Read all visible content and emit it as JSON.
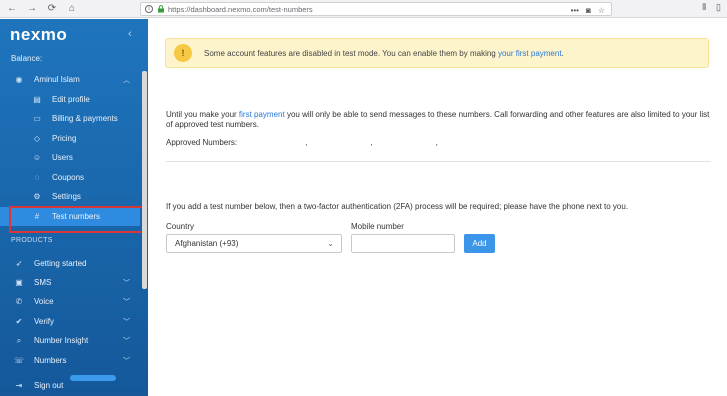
{
  "browser": {
    "url": "https://dashboard.nexmo.com/test-numbers",
    "more_label": "•••"
  },
  "sidebar": {
    "logo": "nexmo",
    "balance_label": "Balance:",
    "account": {
      "user_label": "Aminul Islam",
      "items": [
        {
          "label": "Edit profile",
          "icon": "edit-icon"
        },
        {
          "label": "Billing & payments",
          "icon": "billing-icon"
        },
        {
          "label": "Pricing",
          "icon": "tag-icon"
        },
        {
          "label": "Users",
          "icon": "users-icon"
        },
        {
          "label": "Coupons",
          "icon": "coupon-icon"
        },
        {
          "label": "Settings",
          "icon": "gear-icon"
        },
        {
          "label": "Test numbers",
          "icon": "hash-icon",
          "active": true
        }
      ]
    },
    "products_label": "PRODUCTS",
    "products": [
      {
        "label": "Getting started",
        "icon": "rocket-icon"
      },
      {
        "label": "SMS",
        "icon": "sms-icon"
      },
      {
        "label": "Voice",
        "icon": "phone-icon"
      },
      {
        "label": "Verify",
        "icon": "check-icon"
      },
      {
        "label": "Number Insight",
        "icon": "insight-icon"
      },
      {
        "label": "Numbers",
        "icon": "numbers-icon"
      }
    ],
    "signout_label": "Sign out"
  },
  "main": {
    "banner": {
      "text": "Some account features are disabled in test mode. You can enable them by making ",
      "link": "your first payment",
      "end": "."
    },
    "paragraph": {
      "pre": "Until you make your ",
      "link": "first payment",
      "post": " you will only be able to send messages to these numbers. Call forwarding and other features are also limited to your list of approved test numbers."
    },
    "approved_label": "Approved Numbers:",
    "twofa_text": "If you add a test number below, then a two-factor authentication (2FA) process will be required; please have the phone next to you.",
    "country_label": "Country",
    "country_value": "Afghanistan (+93)",
    "mobile_label": "Mobile number",
    "mobile_value": "",
    "add_label": "Add"
  },
  "colors": {
    "sidebar": "#1a6db5",
    "accent": "#3b95e8",
    "banner_bg": "#fdf4cc",
    "highlight": "#d93737"
  }
}
